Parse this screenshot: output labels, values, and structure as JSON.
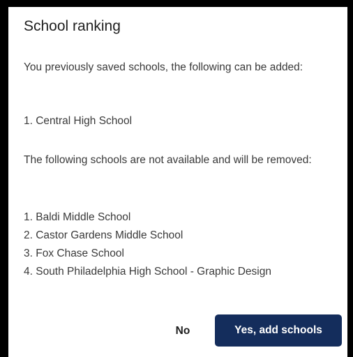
{
  "dialog": {
    "title": "School ranking",
    "intro_text": "You previously saved schools, the following can be added:",
    "addable_schools": [
      "1. Central High School"
    ],
    "removal_text": "The following schools are not available and will be removed:",
    "removed_schools": [
      "1. Baldi Middle School",
      "2. Castor Gardens Middle School",
      "3. Fox Chase School",
      "4. South Philadelphia High School - Graphic Design"
    ],
    "no_label": "No",
    "yes_label": "Yes, add schools"
  },
  "colors": {
    "primary_button": "#142d5c",
    "background": "#ffffff",
    "backdrop": "#000000"
  }
}
